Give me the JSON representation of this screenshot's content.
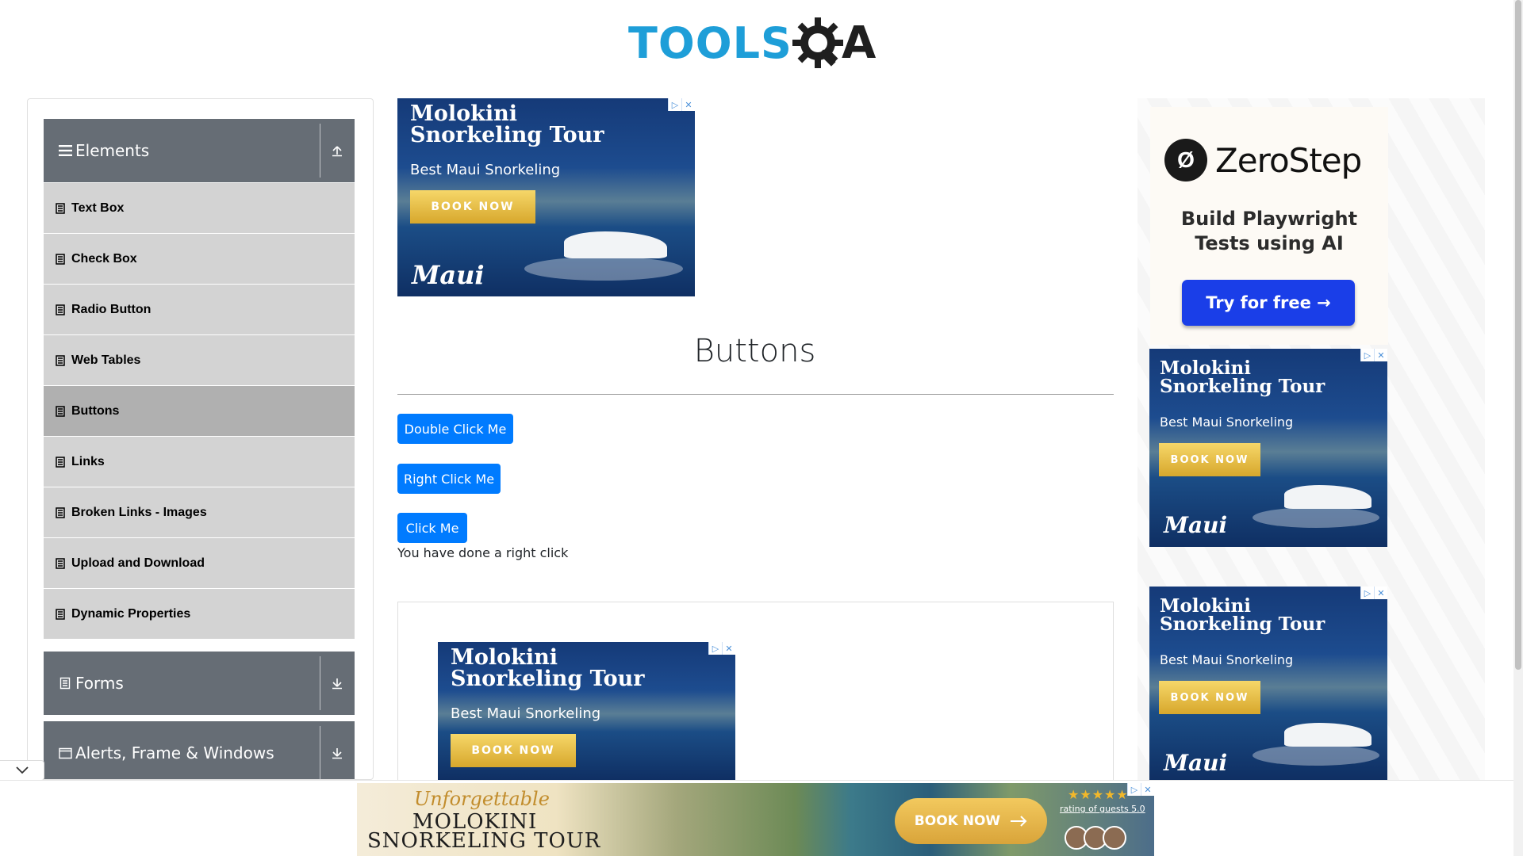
{
  "header": {
    "logo_tools": "TOOLS",
    "logo_a": "A"
  },
  "sidebar": {
    "groups": [
      {
        "label": "Elements",
        "icon": "hamburger-icon",
        "state": "expanded"
      },
      {
        "label": "Forms",
        "icon": "form-icon",
        "state": "collapsed"
      },
      {
        "label": "Alerts, Frame & Windows",
        "icon": "window-icon",
        "state": "collapsed"
      }
    ],
    "items": [
      {
        "label": "Text Box"
      },
      {
        "label": "Check Box"
      },
      {
        "label": "Radio Button"
      },
      {
        "label": "Web Tables"
      },
      {
        "label": "Buttons",
        "active": true
      },
      {
        "label": "Links"
      },
      {
        "label": "Broken Links - Images"
      },
      {
        "label": "Upload and Download"
      },
      {
        "label": "Dynamic Properties"
      }
    ]
  },
  "main": {
    "title": "Buttons",
    "buttons": {
      "double_click": "Double Click Me",
      "right_click": "Right Click Me",
      "click": "Click Me"
    },
    "result_message": "You have done a right click"
  },
  "ads": {
    "molokini": {
      "title_line1": "Molokini",
      "title_line2": "Snorkeling Tour",
      "subtitle": "Best Maui Snorkeling",
      "button": "BOOK NOW",
      "brand": "Maui"
    },
    "zerostep": {
      "name": "ZeroStep",
      "tag_line1": "Build Playwright",
      "tag_line2": "Tests using AI",
      "button": "Try for free →"
    },
    "bottom": {
      "script": "Unforgettable",
      "line1": "MOLOKINI",
      "line2": "SNORKELING TOUR",
      "button": "BOOK NOW",
      "rating": "rating of guests 5.0",
      "stars": "★★★★★"
    }
  },
  "colors": {
    "primary_button": "#007bff",
    "sidebar_header": "#666d75",
    "sidebar_item": "#d3d3d3",
    "sidebar_item_active": "#b0b0b0",
    "logo_blue": "#1e9ed8"
  }
}
